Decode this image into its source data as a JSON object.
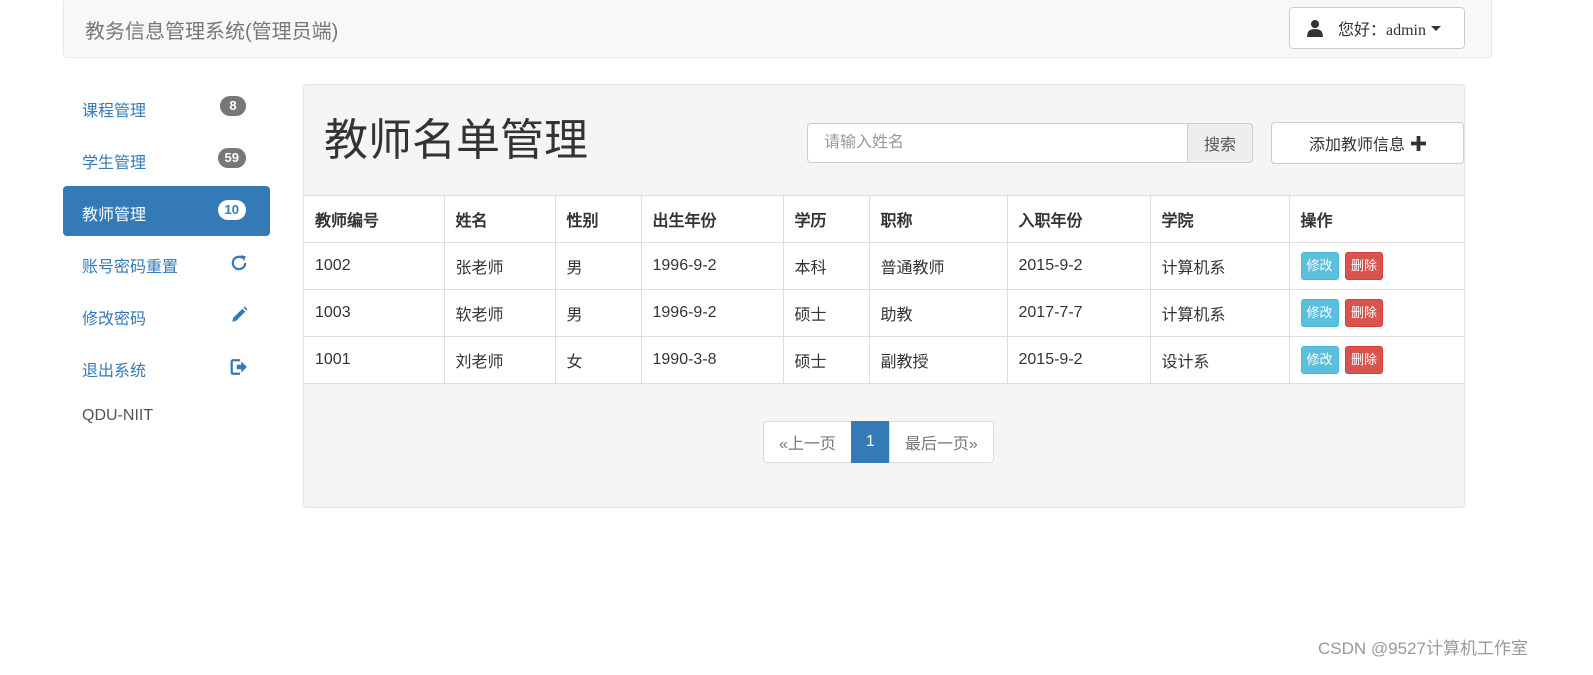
{
  "navbar": {
    "brand": "教务信息管理系统(管理员端)",
    "user_menu": "您好：admin"
  },
  "sidebar": {
    "items": [
      {
        "label": "课程管理",
        "badge": "8",
        "icon": ""
      },
      {
        "label": "学生管理",
        "badge": "59",
        "icon": ""
      },
      {
        "label": "教师管理",
        "badge": "10",
        "icon": "",
        "active": true
      },
      {
        "label": "账号密码重置",
        "badge": "",
        "icon": "refresh-icon"
      },
      {
        "label": "修改密码",
        "badge": "",
        "icon": "pencil-icon"
      },
      {
        "label": "退出系统",
        "badge": "",
        "icon": "logout-icon"
      }
    ],
    "footer": "QDU-NIIT"
  },
  "main": {
    "title": "教师名单管理",
    "search": {
      "placeholder": "请输入姓名",
      "value": "",
      "button": "搜索"
    },
    "add_button": "添加教师信息"
  },
  "table": {
    "headers": [
      "教师编号",
      "姓名",
      "性别",
      "出生年份",
      "学历",
      "职称",
      "入职年份",
      "学院",
      "操作"
    ],
    "rows": [
      [
        "1002",
        "张老师",
        "男",
        "1996-9-2",
        "本科",
        "普通教师",
        "2015-9-2",
        "计算机系"
      ],
      [
        "1003",
        "软老师",
        "男",
        "1996-9-2",
        "硕士",
        "助教",
        "2017-7-7",
        "计算机系"
      ],
      [
        "1001",
        "刘老师",
        "女",
        "1990-3-8",
        "硕士",
        "副教授",
        "2015-9-2",
        "设计系"
      ]
    ],
    "edit_label": "修改",
    "delete_label": "删除"
  },
  "pagination": {
    "prev": "«上一页",
    "current": "1",
    "last": "最后一页»"
  },
  "watermark": "CSDN @9527计算机工作室",
  "colors": {
    "primary": "#337ab7",
    "info": "#5bc0de",
    "danger": "#d9534f",
    "badge": "#777777"
  }
}
